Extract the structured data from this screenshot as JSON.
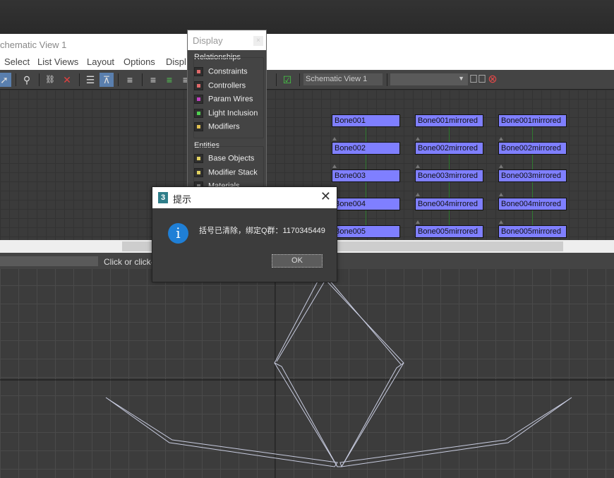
{
  "window": {
    "title": "chematic View 1"
  },
  "menu": [
    "Select",
    "List Views",
    "Layout",
    "Options",
    "Displ"
  ],
  "toolbar": {
    "view_name": "Schematic View 1",
    "combo_value": "",
    "icons": [
      "select-arrow-icon",
      "connect-icon",
      "unlink-icon",
      "delete-icon",
      "hierarchy-mode-icon",
      "references-mode-icon",
      "align-icon",
      "align-left-icon",
      "align-center-icon",
      "align-right-icon",
      "checkbox-icon",
      "go-icon",
      "close-icon"
    ]
  },
  "nodes": [
    [
      "Bone001",
      "Bone001mirrored",
      "Bone001mirrored"
    ],
    [
      "Bone002",
      "Bone002mirrored",
      "Bone002mirrored"
    ],
    [
      "Bone003",
      "Bone003mirrored",
      "Bone003mirrored"
    ],
    [
      "Bone004",
      "Bone004mirrored",
      "Bone004mirrored"
    ],
    [
      "Bone005",
      "Bone005mirrored",
      "Bone005mirrored"
    ]
  ],
  "display_panel": {
    "title": "Display",
    "close": "×",
    "relationships_label": "Relationships",
    "relationships": [
      {
        "label": "Constraints",
        "color": "#e06a6a"
      },
      {
        "label": "Controllers",
        "color": "#e06a6a"
      },
      {
        "label": "Param Wires",
        "color": "#c040c0"
      },
      {
        "label": "Light Inclusion",
        "color": "#50d050"
      },
      {
        "label": "Modifiers",
        "color": "#e0c050"
      }
    ],
    "entities_label": "Entities",
    "entities": [
      {
        "label": "Base Objects",
        "color": "#e0d060"
      },
      {
        "label": "Modifier Stack",
        "color": "#e0d060"
      },
      {
        "label": "Materials",
        "color": "#888888"
      }
    ]
  },
  "status": {
    "prompt": "Click or click-a"
  },
  "dialog": {
    "logo": "3",
    "title": "提示",
    "close": "✕",
    "icon": "i",
    "message": "括号已清除，绑定Q群：1170345449",
    "ok": "OK"
  },
  "colors": {
    "node": "#7f7fff",
    "accent": "#1f7fd6"
  }
}
